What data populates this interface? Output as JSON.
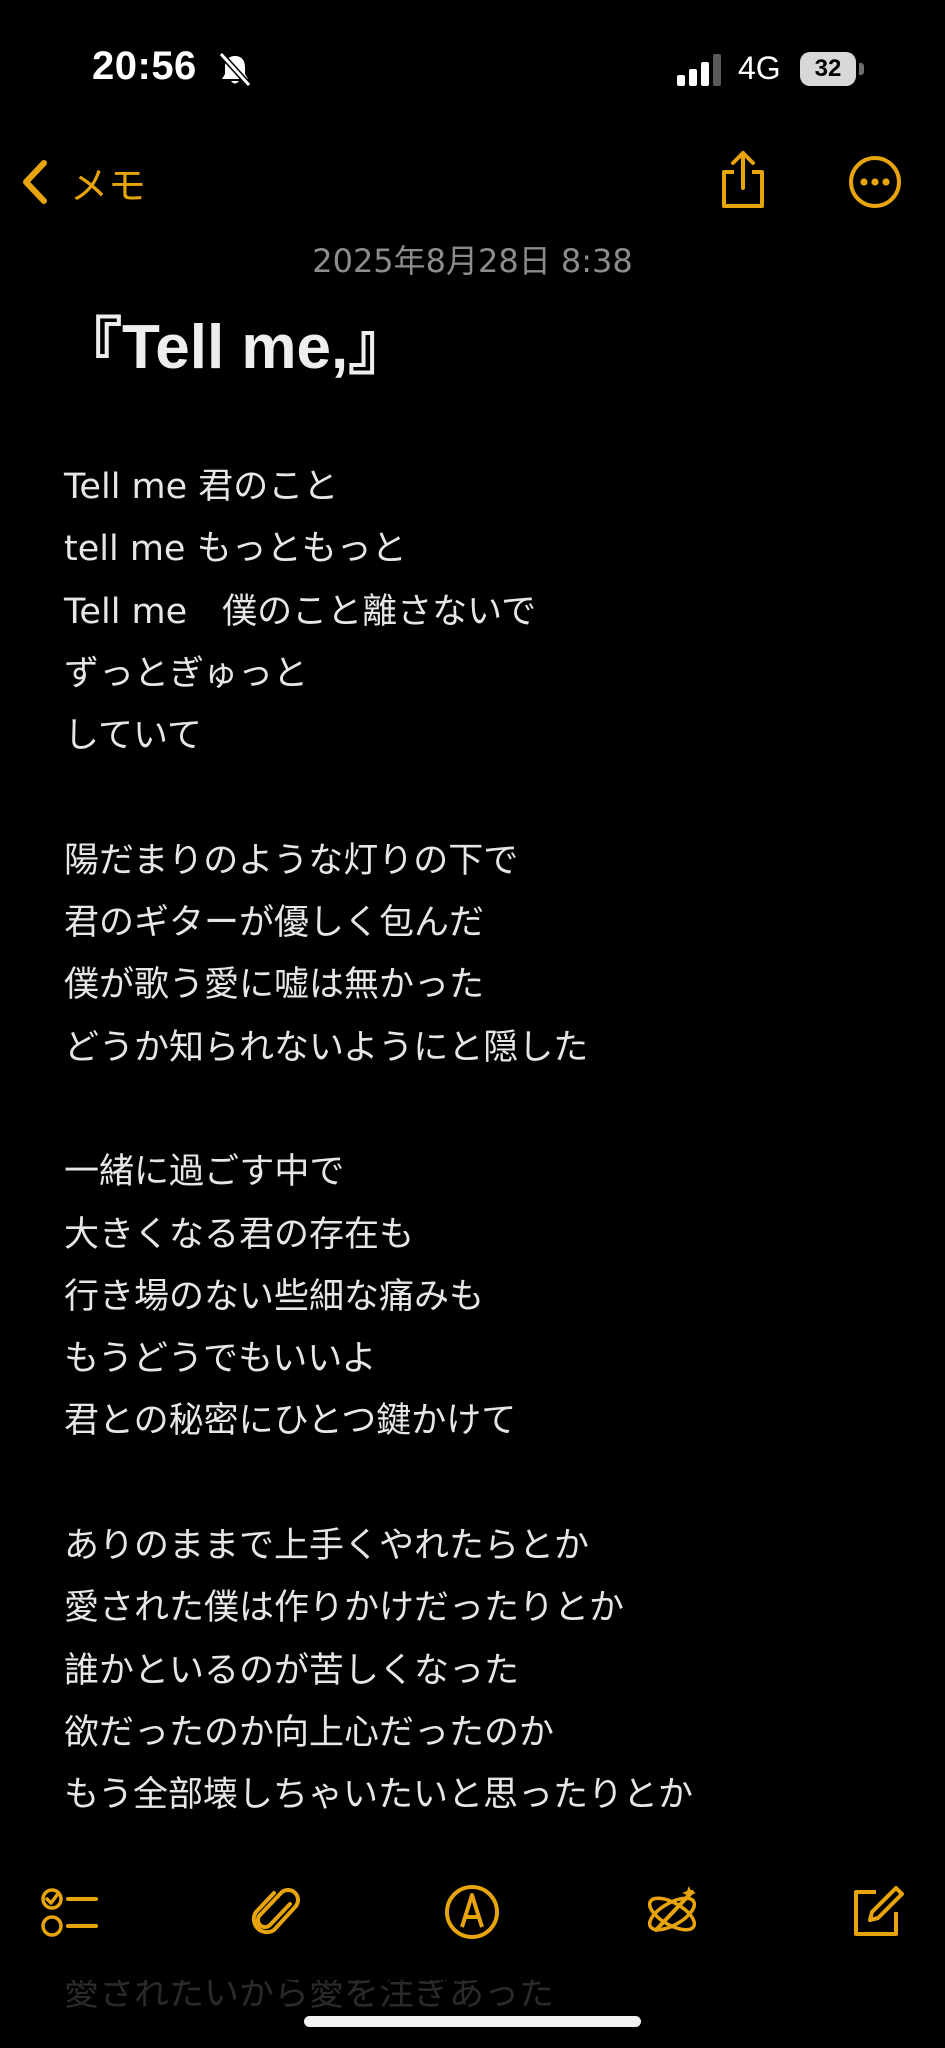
{
  "status_bar": {
    "time": "20:56",
    "network": "4G",
    "battery": "32"
  },
  "nav": {
    "back_label": "メモ"
  },
  "note": {
    "date": "2025年8月28日 8:38",
    "title": "『Tell me,』",
    "lines": [
      "Tell me 君のこと",
      "tell me もっともっと",
      "Tell me　僕のこと離さないで",
      "ずっとぎゅっと",
      "していて",
      "",
      "陽だまりのような灯りの下で",
      "君のギターが優しく包んだ",
      "僕が歌う愛に嘘は無かった",
      "どうか知られないようにと隠した",
      "",
      "一緒に過ごす中で",
      "大きくなる君の存在も",
      "行き場のない些細な痛みも",
      "もうどうでもいいよ",
      "君との秘密にひとつ鍵かけて",
      "",
      "ありのままで上手くやれたらとか",
      "愛された僕は作りかけだったりとか",
      "誰かといるのが苦しくなった",
      "欲だったのか向上心だったのか",
      "もう全部壊しちゃいたいと思ったりとか"
    ],
    "partial_line_below_toolbar": "愛されたいから愛を注ぎあった"
  },
  "toolbar": {
    "icons": [
      "checklist-icon",
      "attachment-icon",
      "markup-icon",
      "writing-tools-icon",
      "compose-icon"
    ]
  },
  "colors": {
    "accent": "#e8a40c",
    "background": "#000000",
    "text": "#e6e6e6",
    "date_text": "#8c8c8c"
  }
}
